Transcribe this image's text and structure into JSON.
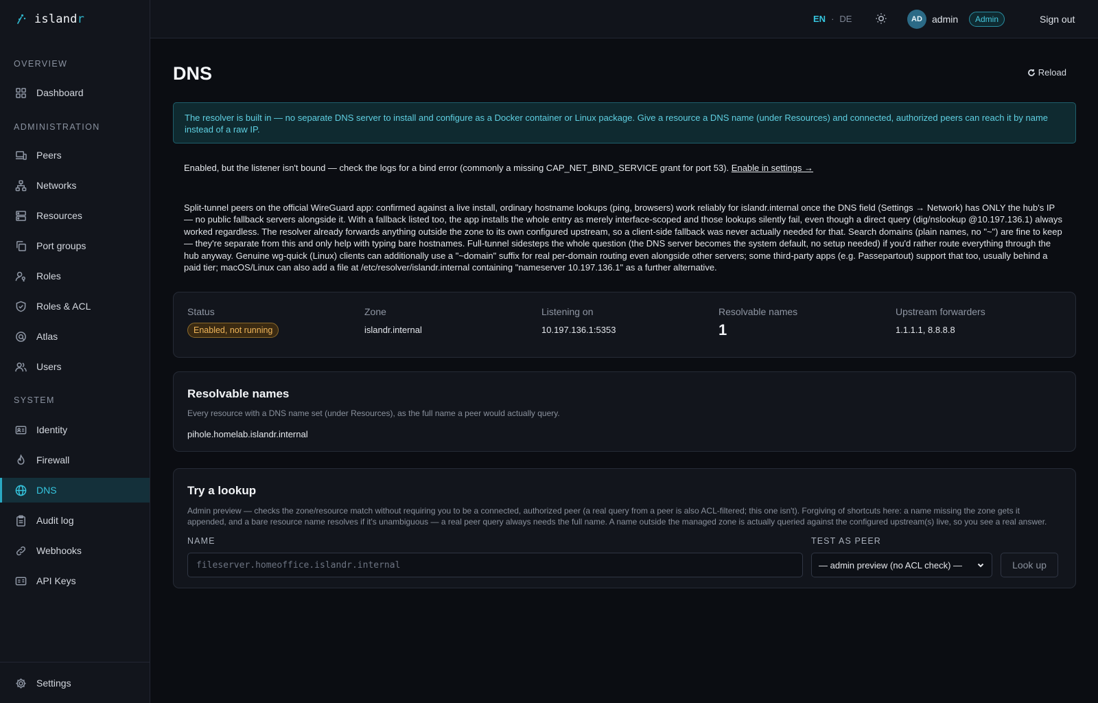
{
  "brand": {
    "name_main": "island",
    "name_accent": "r"
  },
  "sidebar": {
    "sections": [
      "OVERVIEW",
      "ADMINISTRATION",
      "SYSTEM"
    ],
    "items": [
      {
        "label": "Dashboard",
        "icon": "grid-icon"
      },
      {
        "label": "Peers",
        "icon": "laptop-icon"
      },
      {
        "label": "Networks",
        "icon": "network-icon"
      },
      {
        "label": "Resources",
        "icon": "server-icon"
      },
      {
        "label": "Port groups",
        "icon": "copy-icon"
      },
      {
        "label": "Roles",
        "icon": "user-key-icon"
      },
      {
        "label": "Roles & ACL",
        "icon": "shield-icon"
      },
      {
        "label": "Atlas",
        "icon": "globe-lens-icon"
      },
      {
        "label": "Users",
        "icon": "users-icon"
      },
      {
        "label": "Identity",
        "icon": "id-card-icon"
      },
      {
        "label": "Firewall",
        "icon": "flame-icon"
      },
      {
        "label": "DNS",
        "icon": "globe-icon",
        "active": true
      },
      {
        "label": "Audit log",
        "icon": "clipboard-icon"
      },
      {
        "label": "Webhooks",
        "icon": "link-icon"
      },
      {
        "label": "API Keys",
        "icon": "key-card-icon"
      }
    ],
    "footer": {
      "label": "Settings",
      "icon": "gear-icon"
    }
  },
  "topbar": {
    "lang_active": "EN",
    "lang_sep": "·",
    "lang_other": "DE",
    "avatar_initials": "AD",
    "username": "admin",
    "role": "Admin",
    "signout": "Sign out"
  },
  "page": {
    "title": "DNS",
    "reload": "Reload",
    "info": "The resolver is built in — no separate DNS server to install and configure as a Docker container or Linux package. Give a resource a DNS name (under Resources) and connected, authorized peers can reach it by name instead of a raw IP.",
    "notice": "Enabled, but the listener isn't bound — check the logs for a bind error (commonly a missing CAP_NET_BIND_SERVICE grant for port 53).",
    "notice_link": "Enable in settings →",
    "longtext": "Split-tunnel peers on the official WireGuard app: confirmed against a live install, ordinary hostname lookups (ping, browsers) work reliably for islandr.internal once the DNS field (Settings → Network) has ONLY the hub's IP — no public fallback servers alongside it. With a fallback listed too, the app installs the whole entry as merely interface-scoped and those lookups silently fail, even though a direct query (dig/nslookup @10.197.136.1) always worked regardless. The resolver already forwards anything outside the zone to its own configured upstream, so a client-side fallback was never actually needed for that. Search domains (plain names, no \"~\") are fine to keep — they're separate from this and only help with typing bare hostnames. Full-tunnel sidesteps the whole question (the DNS server becomes the system default, no setup needed) if you'd rather route everything through the hub anyway. Genuine wg-quick (Linux) clients can additionally use a \"~domain\" suffix for real per-domain routing even alongside other servers; some third-party apps (e.g. Passepartout) support that too, usually behind a paid tier; macOS/Linux can also add a file at /etc/resolver/islandr.internal containing \"nameserver 10.197.136.1\" as a further alternative."
  },
  "stats": {
    "status_label": "Status",
    "status_value": "Enabled, not running",
    "zone_label": "Zone",
    "zone_value": "islandr.internal",
    "listen_label": "Listening on",
    "listen_value": "10.197.136.1:5353",
    "names_label": "Resolvable names",
    "names_value": "1",
    "upstream_label": "Upstream forwarders",
    "upstream_value": "1.1.1.1, 8.8.8.8"
  },
  "resolvable": {
    "title": "Resolvable names",
    "subtitle": "Every resource with a DNS name set (under Resources), as the full name a peer would actually query.",
    "items": [
      "pihole.homelab.islandr.internal"
    ]
  },
  "lookup": {
    "title": "Try a lookup",
    "subtitle": "Admin preview — checks the zone/resource match without requiring you to be a connected, authorized peer (a real query from a peer is also ACL-filtered; this one isn't). Forgiving of shortcuts here: a name missing the zone gets it appended, and a bare resource name resolves if it's unambiguous — a real peer query always needs the full name. A name outside the managed zone is actually queried against the configured upstream(s) live, so you see a real answer.",
    "name_label": "NAME",
    "name_placeholder": "fileserver.homeoffice.islandr.internal",
    "peer_label": "TEST AS PEER",
    "peer_value": "— admin preview (no ACL check) —",
    "button": "Look up"
  }
}
